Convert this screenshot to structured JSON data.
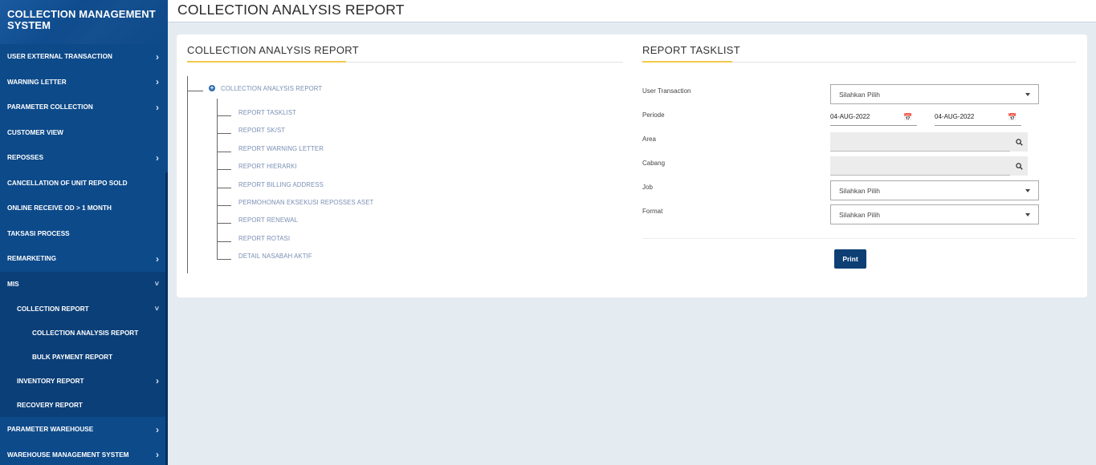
{
  "sidebar": {
    "brand": "COLLECTION MANAGEMENT SYSTEM",
    "items": [
      {
        "label": "USER EXTERNAL TRANSACTION",
        "chevron": "right"
      },
      {
        "label": "WARNING LETTER",
        "chevron": "right"
      },
      {
        "label": "PARAMETER COLLECTION",
        "chevron": "right"
      },
      {
        "label": "CUSTOMER VIEW",
        "chevron": ""
      },
      {
        "label": "REPOSSES",
        "chevron": "right"
      },
      {
        "label": "CANCELLATION OF UNIT REPO SOLD",
        "chevron": ""
      },
      {
        "label": "ONLINE RECEIVE OD > 1 MONTH",
        "chevron": ""
      },
      {
        "label": "TAKSASI PROCESS",
        "chevron": ""
      },
      {
        "label": "REMARKETING",
        "chevron": "right"
      },
      {
        "label": "MIS",
        "chevron": "down"
      },
      {
        "label": "COLLECTION REPORT",
        "chevron": "down"
      },
      {
        "label": "COLLECTION ANALYSIS REPORT",
        "chevron": ""
      },
      {
        "label": "BULK PAYMENT REPORT",
        "chevron": ""
      },
      {
        "label": "INVENTORY REPORT",
        "chevron": "right"
      },
      {
        "label": "RECOVERY REPORT",
        "chevron": ""
      },
      {
        "label": "PARAMETER WAREHOUSE",
        "chevron": "right"
      },
      {
        "label": "WAREHOUSE MANAGEMENT SYSTEM",
        "chevron": "right"
      }
    ]
  },
  "header": {
    "title": "COLLECTION ANALYSIS REPORT"
  },
  "left_panel": {
    "title": "COLLECTION ANALYSIS REPORT",
    "tree_root": "COLLECTION ANALYSIS REPORT",
    "tree_items": [
      "REPORT TASKLIST",
      "REPORT SK/ST",
      "REPORT WARNING LETTER",
      "REPORT HIERARKI",
      "REPORT BILLING ADDRESS",
      "PERMOHONAN EKSEKUSI REPOSSES ASET",
      "REPORT RENEWAL",
      "REPORT ROTASI",
      "DETAIL NASABAH AKTIF"
    ]
  },
  "right_panel": {
    "title": "REPORT TASKLIST",
    "labels": {
      "user_transaction": "User Transaction",
      "periode": "Periode",
      "area": "Area",
      "cabang": "Cabang",
      "job": "Job",
      "format": "Format"
    },
    "user_transaction_value": "Silahkan Pilih",
    "periode_from": "04-AUG-2022",
    "periode_to": "04-AUG-2022",
    "area_value": "",
    "cabang_value": "",
    "job_value": "Silahkan Pilih",
    "format_value": "Silahkan Pilih",
    "print_label": "Print"
  },
  "colors": {
    "sidebar": "#0d4a8a",
    "accent_underline": "#f2c94c",
    "button": "#0d3f75",
    "tree_link": "#7a8fb5"
  }
}
